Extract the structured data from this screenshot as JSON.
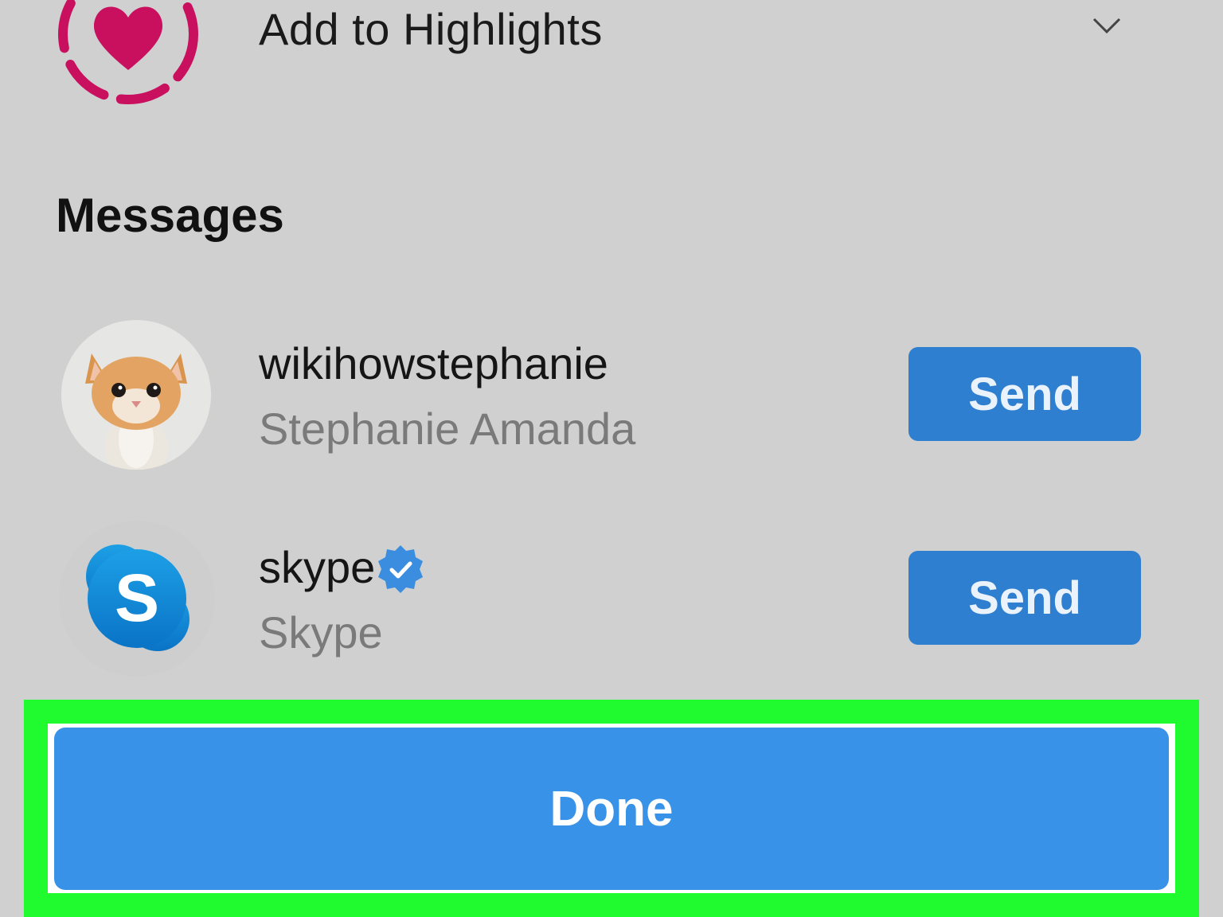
{
  "highlights": {
    "title": "Add to Highlights",
    "icon": "heart-icon",
    "expand_icon": "chevron-down-icon",
    "accent_color": "#c8105f"
  },
  "messages": {
    "heading": "Messages",
    "contacts": [
      {
        "username": "wikihowstephanie",
        "full_name": "Stephanie Amanda",
        "avatar": "kitten-photo",
        "verified": false,
        "action_label": "Send"
      },
      {
        "username": "skype",
        "full_name": "Skype",
        "avatar": "skype-logo-icon",
        "verified": true,
        "action_label": "Send"
      }
    ]
  },
  "footer": {
    "done_label": "Done"
  },
  "colors": {
    "background": "#d0d0d0",
    "send_button": "#2f7fd0",
    "done_button": "#3792e8",
    "highlight_box": "#1ffb2e",
    "verified_badge": "#3b8de0"
  }
}
